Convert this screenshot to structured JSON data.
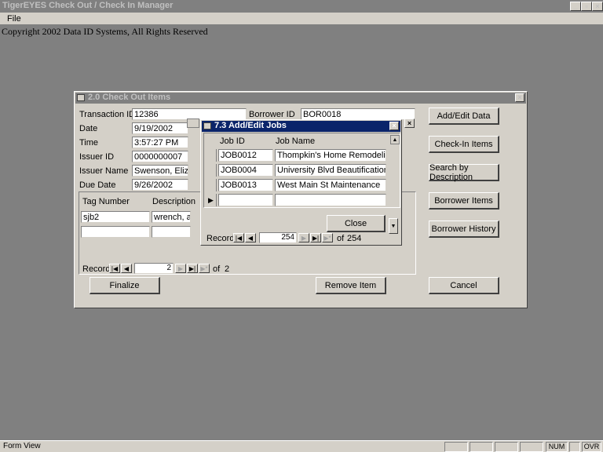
{
  "app": {
    "title": "TigerEYES Check Out / Check In Manager",
    "menu": [
      "File"
    ],
    "copyright": "Copyright 2002 Data ID Systems, All Rights Reserved",
    "status_left": "Form View",
    "status_num": "NUM",
    "status_ovr": "OVR"
  },
  "checkout": {
    "title": "2.0  Check Out Items",
    "labels": {
      "transaction_id": "Transaction ID",
      "date": "Date",
      "time": "Time",
      "issuer_id": "Issuer ID",
      "issuer_name": "Issuer Name",
      "due_date": "Due Date",
      "borrower_id": "Borrower ID"
    },
    "values": {
      "transaction_id": "12386",
      "date": "9/19/2002",
      "time": "3:57:27 PM",
      "issuer_id": "0000000007",
      "issuer_name": "Swenson, Elizabeth",
      "due_date": "9/26/2002",
      "borrower_id": "BOR0018"
    },
    "items_headers": [
      "Tag Number",
      "Description"
    ],
    "items": [
      {
        "tag": "sjb2",
        "desc": "wrench, adjustable"
      },
      {
        "tag": "",
        "desc": ""
      }
    ],
    "record_label": "Record:",
    "record_current": "2",
    "record_of": "of",
    "record_total": "2",
    "buttons": {
      "add_edit": "Add/Edit Data",
      "check_in": "Check-In Items",
      "search_desc": "Search by Description",
      "borrower_items": "Borrower Items",
      "borrower_history": "Borrower History",
      "finalize": "Finalize",
      "remove_item": "Remove Item",
      "cancel": "Cancel"
    }
  },
  "jobs": {
    "title": "7.3  Add/Edit Jobs",
    "headers": [
      "Job ID",
      "Job Name"
    ],
    "rows": [
      {
        "id": "JOB0012",
        "name": "Thompkin's Home Remodeling"
      },
      {
        "id": "JOB0004",
        "name": "University Blvd Beautification"
      },
      {
        "id": "JOB0013",
        "name": "West Main St Maintenance"
      }
    ],
    "close": "Close",
    "record_label": "Record:",
    "record_current": "254",
    "record_of": "of",
    "record_total": "254"
  }
}
